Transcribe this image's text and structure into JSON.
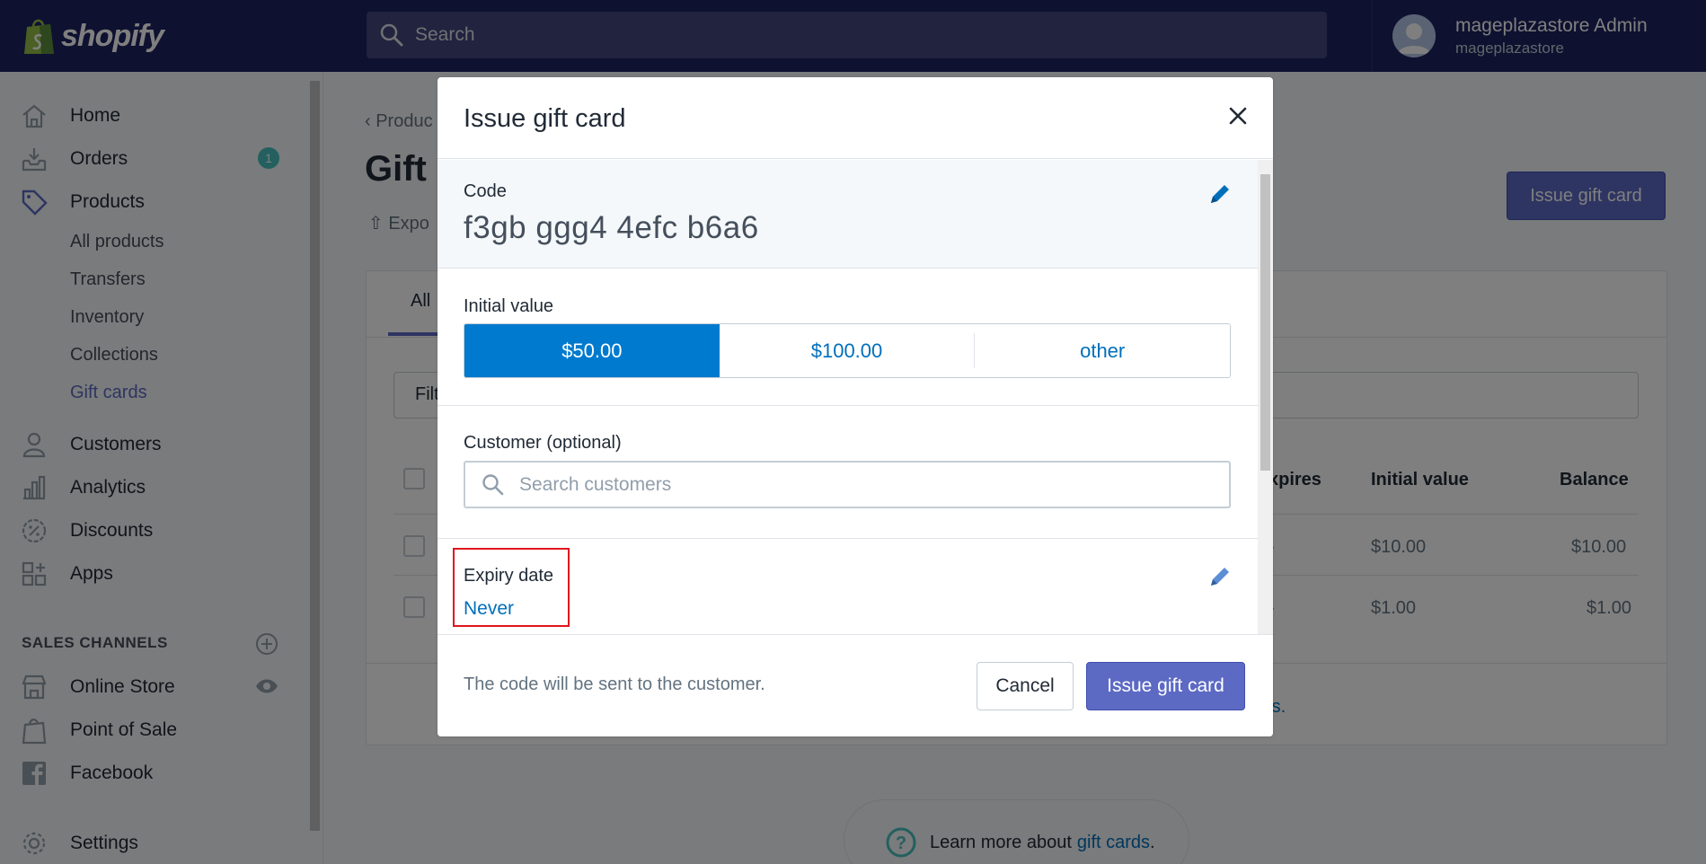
{
  "topbar": {
    "brand": "shopify",
    "search_placeholder": "Search",
    "user_name": "mageplazastore Admin",
    "user_store": "mageplazastore"
  },
  "sidebar": {
    "items": [
      {
        "label": "Home",
        "icon": "home-icon"
      },
      {
        "label": "Orders",
        "icon": "orders-icon",
        "badge": "1"
      },
      {
        "label": "Products",
        "icon": "tag-icon"
      }
    ],
    "product_subitems": [
      "All products",
      "Transfers",
      "Inventory",
      "Collections",
      "Gift cards"
    ],
    "more_items": [
      {
        "label": "Customers",
        "icon": "person-icon"
      },
      {
        "label": "Analytics",
        "icon": "bar-chart-icon"
      },
      {
        "label": "Discounts",
        "icon": "discount-icon"
      },
      {
        "label": "Apps",
        "icon": "apps-icon"
      }
    ],
    "sales_channels_title": "SALES CHANNELS",
    "channels": [
      {
        "label": "Online Store",
        "icon": "store-icon"
      },
      {
        "label": "Point of Sale",
        "icon": "pos-bag-icon"
      },
      {
        "label": "Facebook",
        "icon": "facebook-icon"
      }
    ],
    "settings_label": "Settings"
  },
  "page": {
    "breadcrumb": "Produc",
    "title": "Gift",
    "export_label": "Expo",
    "issue_button": "Issue gift card",
    "tab_all": "All",
    "filter_text": "Filt",
    "columns": {
      "expires": "xpires",
      "initial_value": "Initial value",
      "balance": "Balance"
    },
    "rows": [
      {
        "expires": "-",
        "initial_value": "$10.00",
        "balance": "$10.00"
      },
      {
        "expires": "-",
        "initial_value": "$1.00",
        "balance": "$1.00"
      }
    ],
    "footer_link_fragment": "rs.",
    "learn_text": "Learn more about",
    "learn_link": "gift cards",
    "learn_suffix": "."
  },
  "modal": {
    "title": "Issue gift card",
    "code_label": "Code",
    "code_value": "f3gb ggg4 4efc b6a6",
    "initial_value_label": "Initial value",
    "values": [
      "$50.00",
      "$100.00",
      "other"
    ],
    "selected_value": "$50.00",
    "customer_label": "Customer (optional)",
    "customer_placeholder": "Search customers",
    "expiry_label": "Expiry date",
    "expiry_value": "Never",
    "footer_text": "The code will be sent to the customer.",
    "cancel_label": "Cancel",
    "issue_label": "Issue gift card"
  },
  "colors": {
    "topbar": "#1c2260",
    "accent": "#5c6ac4",
    "selected_segment": "#007ace",
    "link": "#006fbb",
    "highlight_box": "#e0141e"
  }
}
